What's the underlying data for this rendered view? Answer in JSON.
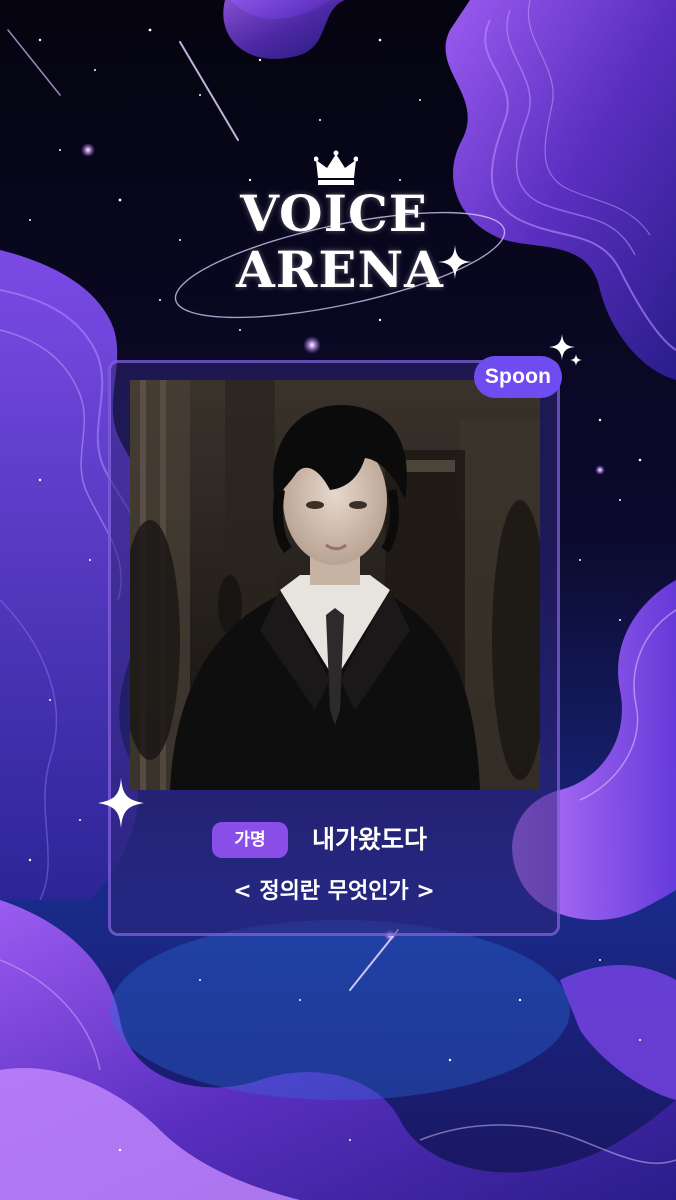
{
  "logo": {
    "line1": "VOICE",
    "line2": "ARENA"
  },
  "badge": {
    "brand": "Spoon"
  },
  "entry": {
    "label": "가명",
    "name": "내가왔도다",
    "title": "< 정의란 무엇인가 >"
  },
  "icons": {
    "crown": "crown-icon",
    "sparkle": "sparkle-icon"
  },
  "colors": {
    "background": "#070716",
    "accent_purple": "#8a4fe8",
    "badge_purple": "#6f4cf0",
    "card_border": "#a078ff"
  }
}
